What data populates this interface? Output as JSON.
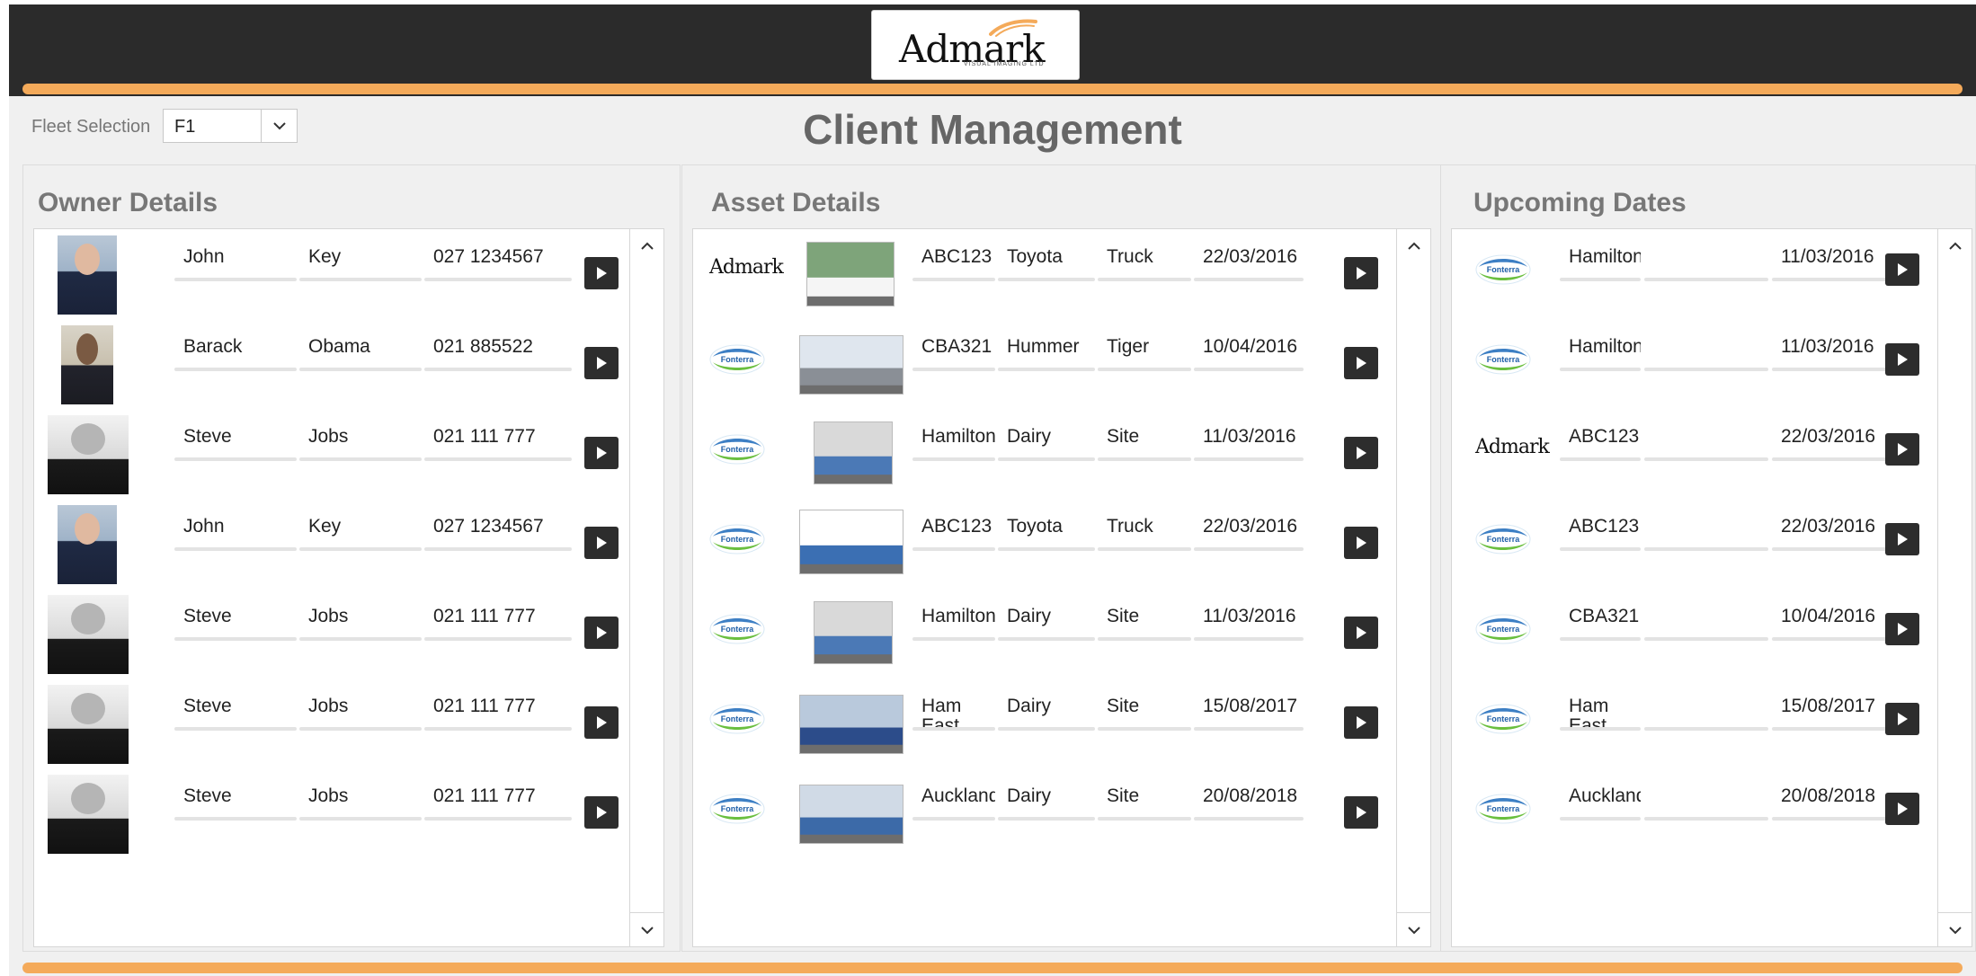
{
  "header": {
    "logo_text": "Admark",
    "logo_tagline": "VISUAL IMAGING LTD",
    "accent_color": "#f4aa5a",
    "bar_color": "#2b2b2b"
  },
  "fleet": {
    "label": "Fleet Selection",
    "value": "F1"
  },
  "page_title": "Client Management",
  "owner": {
    "title": "Owner Details",
    "rows": [
      {
        "first": "John",
        "last": "Key",
        "phone": "027 1234567",
        "photo": "suit"
      },
      {
        "first": "Barack",
        "last": "Obama",
        "phone": "021 885522",
        "photo": "pres"
      },
      {
        "first": "Steve",
        "last": "Jobs",
        "phone": "021 111 777",
        "photo": "bw"
      },
      {
        "first": "John",
        "last": "Key",
        "phone": "027 1234567",
        "photo": "suit"
      },
      {
        "first": "Steve",
        "last": "Jobs",
        "phone": "021 111 777",
        "photo": "bw"
      },
      {
        "first": "Steve",
        "last": "Jobs",
        "phone": "021 111 777",
        "photo": "bw"
      },
      {
        "first": "Steve",
        "last": "Jobs",
        "phone": "021 111 777",
        "photo": "bw"
      }
    ]
  },
  "asset": {
    "title": "Asset Details",
    "rows": [
      {
        "logo": "admark",
        "name": "ABC123",
        "make": "Toyota",
        "type": "Truck",
        "date": "22/03/2016",
        "thumb": "truck-white"
      },
      {
        "logo": "fonterra",
        "name": "CBA321",
        "make": "Hummer",
        "type": "Tiger",
        "date": "10/04/2016",
        "thumb": "hummer"
      },
      {
        "logo": "fonterra",
        "name": "Hamilton",
        "make": "Dairy",
        "type": "Site",
        "date": "11/03/2016",
        "thumb": "shop"
      },
      {
        "logo": "fonterra",
        "name": "ABC123",
        "make": "Toyota",
        "type": "Truck",
        "date": "22/03/2016",
        "thumb": "truck-wrap"
      },
      {
        "logo": "fonterra",
        "name": "Hamilton",
        "make": "Dairy",
        "type": "Site",
        "date": "11/03/2016",
        "thumb": "shop"
      },
      {
        "logo": "fonterra",
        "name": "Ham East",
        "make": "Dairy",
        "type": "Site",
        "date": "15/08/2017",
        "thumb": "building-blue"
      },
      {
        "logo": "fonterra",
        "name": "Auckland",
        "make": "Dairy",
        "type": "Site",
        "date": "20/08/2018",
        "thumb": "store-front"
      }
    ]
  },
  "upcoming": {
    "title": "Upcoming Dates",
    "rows": [
      {
        "logo": "fonterra",
        "name": "Hamilton",
        "date": "11/03/2016"
      },
      {
        "logo": "fonterra",
        "name": "Hamilton",
        "date": "11/03/2016"
      },
      {
        "logo": "admark",
        "name": "ABC123",
        "date": "22/03/2016"
      },
      {
        "logo": "fonterra",
        "name": "ABC123",
        "date": "22/03/2016"
      },
      {
        "logo": "fonterra",
        "name": "CBA321",
        "date": "10/04/2016"
      },
      {
        "logo": "fonterra",
        "name": "Ham East",
        "date": "15/08/2017"
      },
      {
        "logo": "fonterra",
        "name": "Auckland",
        "date": "20/08/2018"
      }
    ]
  },
  "brand_logos": {
    "fonterra": "Fonterra",
    "admark": "Admark"
  }
}
